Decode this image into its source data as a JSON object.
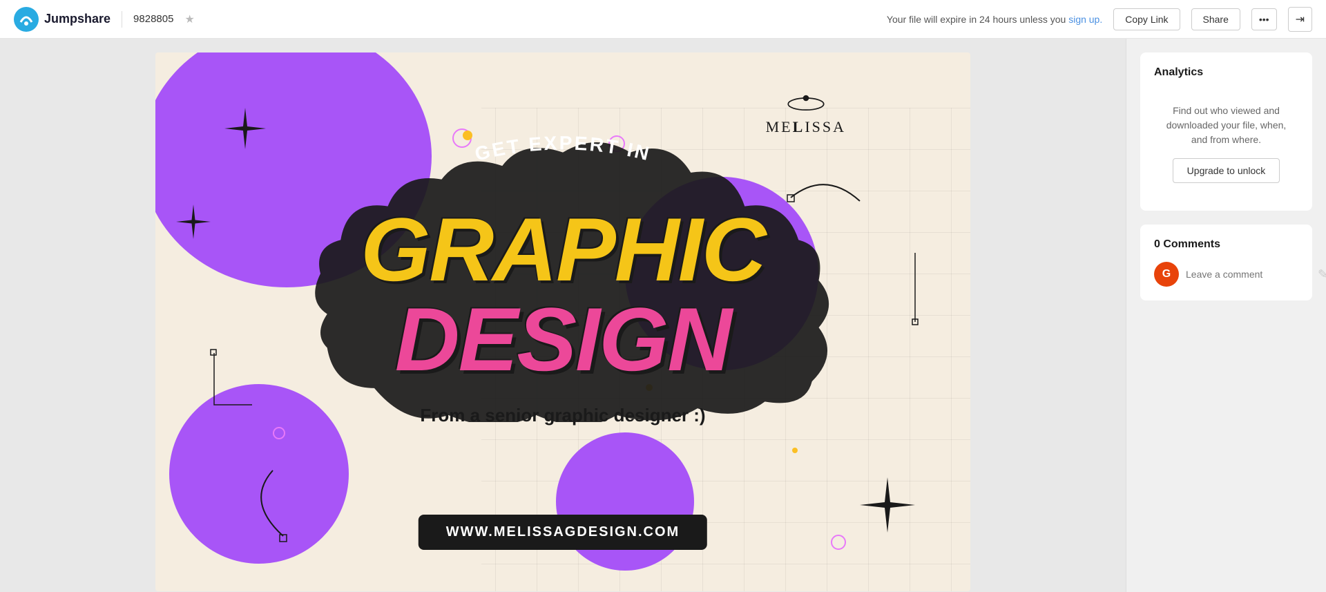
{
  "header": {
    "logo_text": "Jumpshare",
    "file_name": "9828805",
    "star_icon": "★",
    "expiry_text": "Your file will expire in 24 hours unless you",
    "sign_up_link": "sign up.",
    "copy_link_label": "Copy Link",
    "share_label": "Share",
    "dots_label": "•••",
    "exit_icon": "⇥"
  },
  "sidebar": {
    "analytics_title": "Analytics",
    "analytics_desc": "Find out who viewed and downloaded your file, when, and from where.",
    "upgrade_btn_label": "Upgrade to unlock",
    "comments_title": "0 Comments",
    "comment_placeholder": "Leave a comment",
    "avatar_letter": "G"
  },
  "preview": {
    "expert_text": "GET EXPERT IN",
    "graphic_text": "GRAPHIC",
    "design_text": "DESIGN",
    "subtitle_text": "From a senior graphic designer :)",
    "url_text": "WWW.MELISSAGDESIGN.COM",
    "melissa_brand": "MELISSA"
  }
}
